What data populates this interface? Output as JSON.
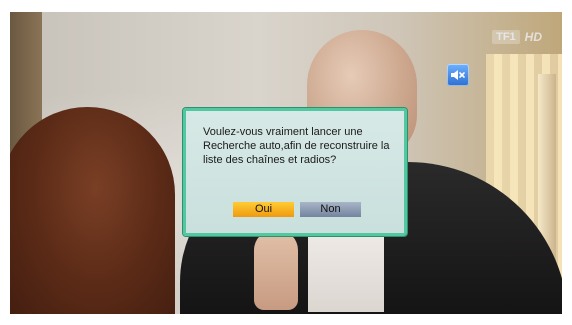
{
  "overlay": {
    "channel_logo": {
      "brand": "TF1",
      "suffix": "HD"
    },
    "mute_icon": "speaker-muted-icon"
  },
  "dialog": {
    "message": "Voulez-vous vraiment lancer une Recherche auto,afin de reconstruire la liste des chaînes et radios?",
    "buttons": {
      "yes": "Oui",
      "no": "Non"
    }
  },
  "colors": {
    "dialog_border": "#52c8a0",
    "dialog_bg": "#cfe5e2",
    "button_selected": "#f4ab1e",
    "button_unselected": "#8b9ab3",
    "mute_bg": "#3f86e6"
  }
}
